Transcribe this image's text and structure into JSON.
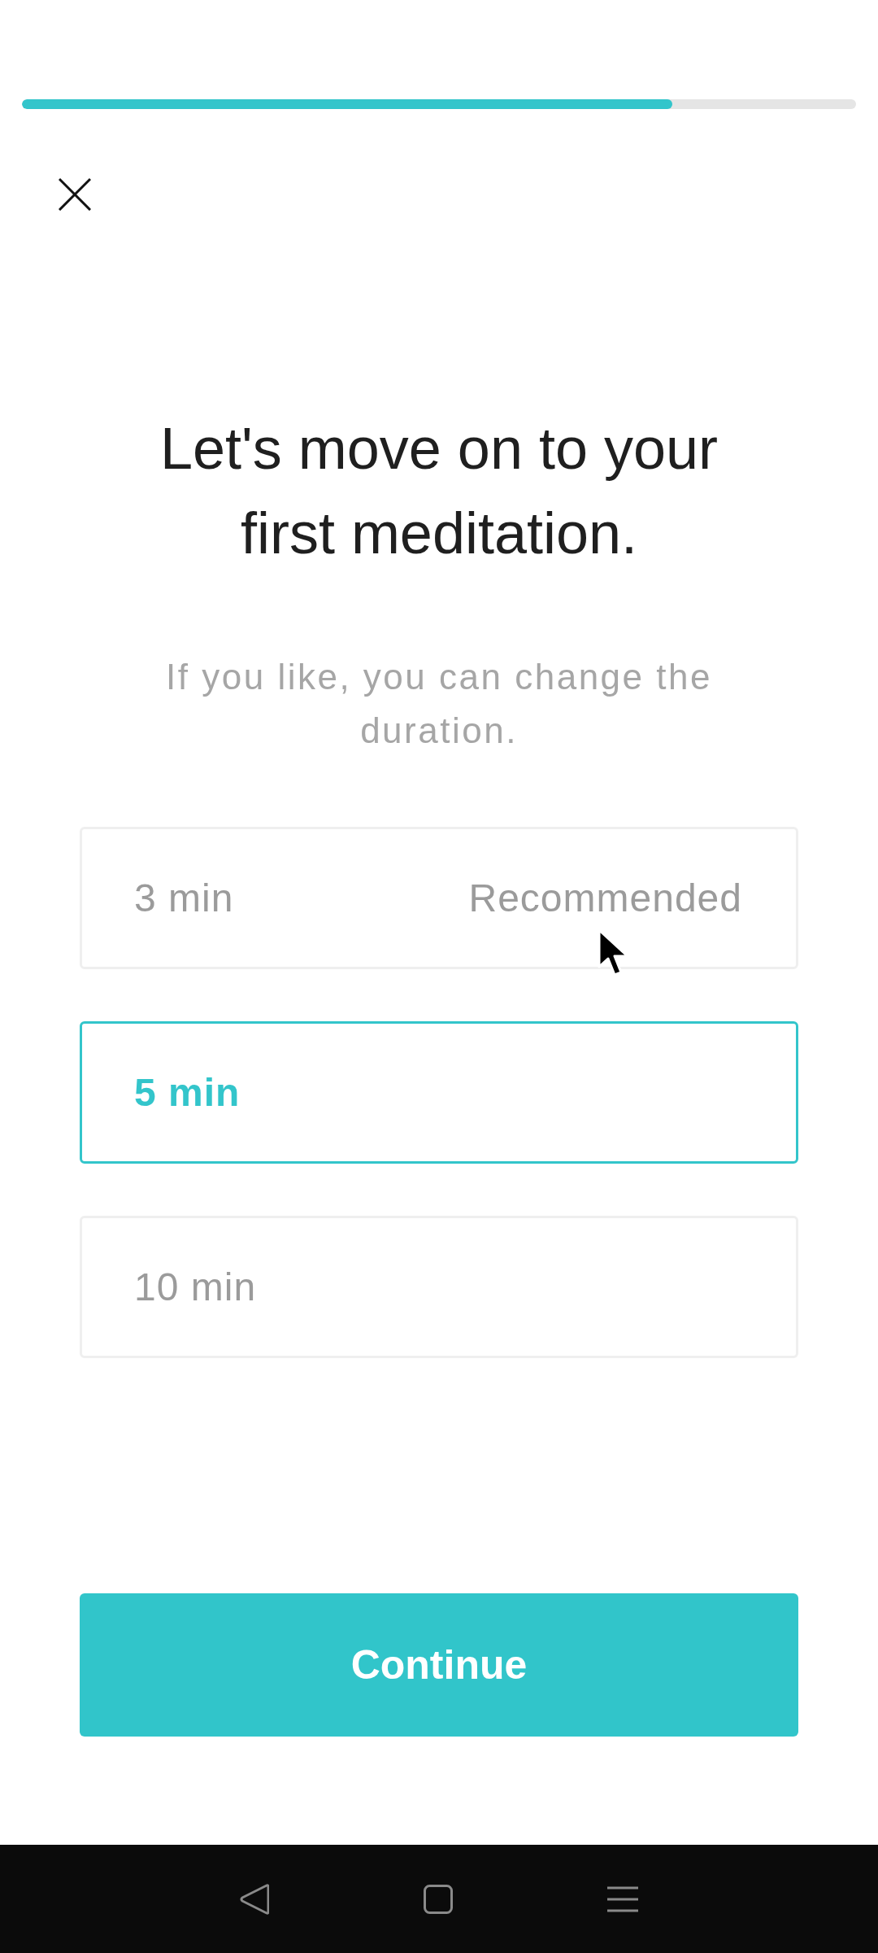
{
  "progress": {
    "level": 0.78
  },
  "title": "Let's move on to your first meditation.",
  "subtitle": "If you like, you can change the duration.",
  "options": [
    {
      "label": "3 min",
      "note": "Recommended",
      "selected": false
    },
    {
      "label": "5 min",
      "selected": true
    },
    {
      "label": "10 min",
      "selected": false
    }
  ],
  "continue_button": {
    "label": "Continue"
  }
}
